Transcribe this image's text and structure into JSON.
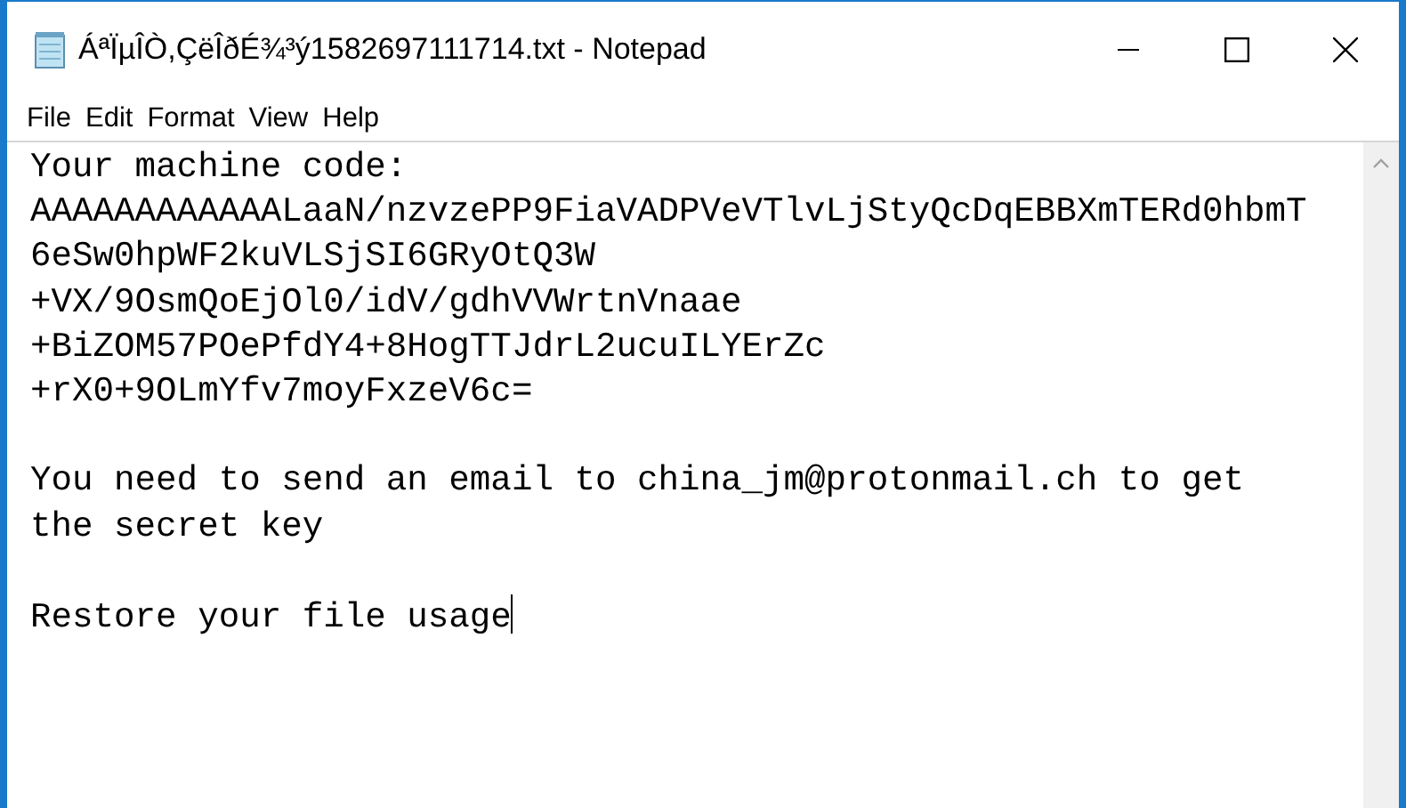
{
  "window": {
    "title": "ÁªÏµÎÒ,ÇëÎðÉ¾³ý1582697111714.txt - Notepad"
  },
  "menu": [
    "File",
    "Edit",
    "Format",
    "View",
    "Help"
  ],
  "editor": {
    "paragraphs": [
      {
        "lines": [
          "Your machine code:",
          "AAAAAAAAAAAALaaN/nzvzePP9FiaVADPVeVTlvLjStyQcDqEBBXmTERd0hbmT",
          "6eSw0hpWF2kuVLSjSI6GRyOtQ3W",
          "+VX/9OsmQoEjOl0/idV/gdhVVWrtnVnaae",
          "+BiZOM57POePfdY4+8HogTTJdrL2ucuILYErZc",
          "+rX0+9OLmYfv7moyFxzeV6c="
        ]
      },
      {
        "lines": [
          "You need to send an email to china_jm@protonmail.ch to get the secret key"
        ]
      },
      {
        "lines": [
          "Restore your file usage"
        ]
      }
    ]
  }
}
